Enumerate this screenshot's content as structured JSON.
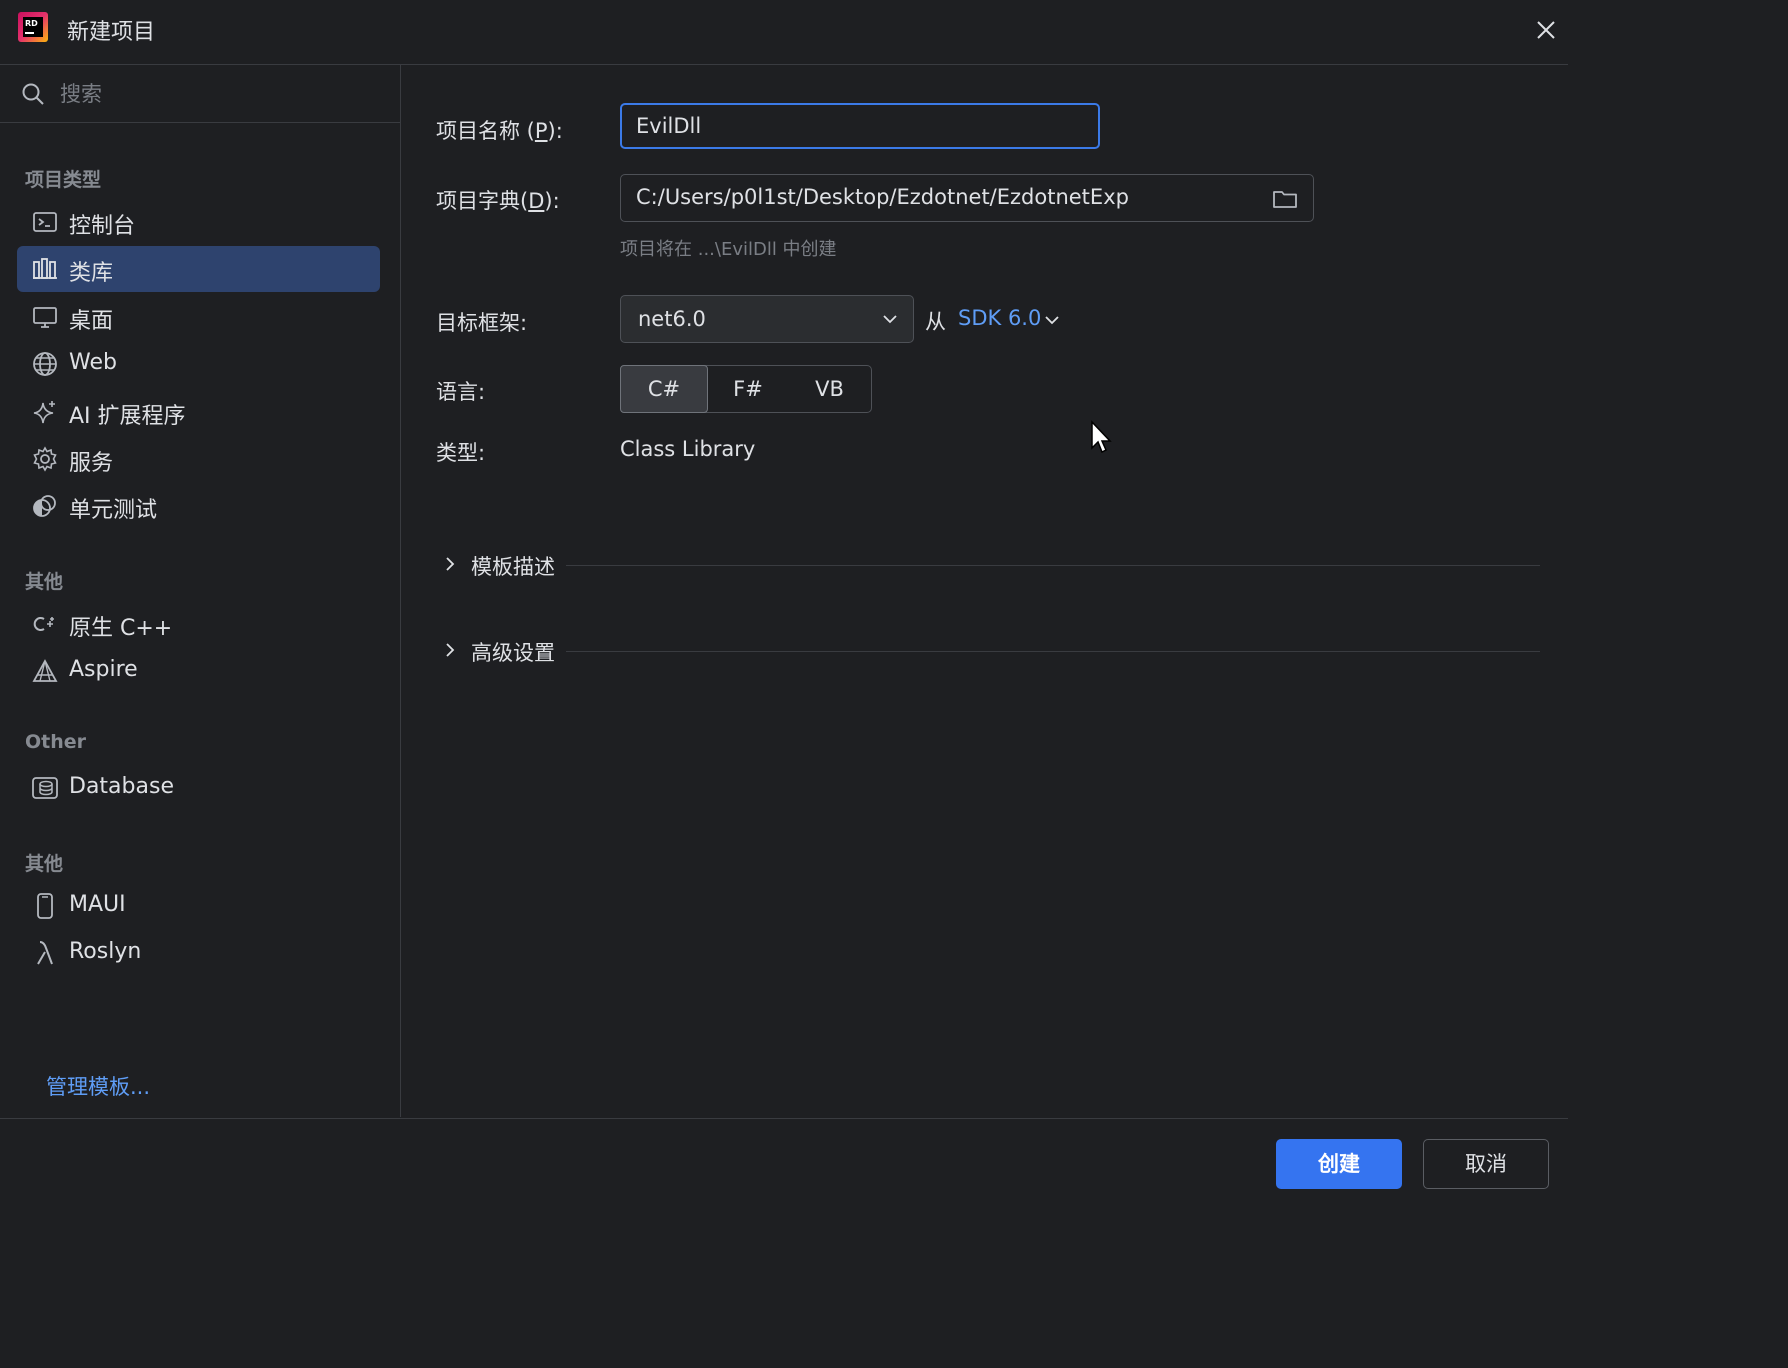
{
  "window": {
    "title": "新建项目",
    "logo_text": "RD"
  },
  "search": {
    "placeholder": "搜索"
  },
  "sidebar": {
    "sections": [
      {
        "title": "项目类型",
        "items": [
          {
            "label": "控制台",
            "icon": "console-icon"
          },
          {
            "label": "类库",
            "icon": "class-library-icon",
            "selected": true
          },
          {
            "label": "桌面",
            "icon": "desktop-icon"
          },
          {
            "label": "Web",
            "icon": "globe-icon"
          },
          {
            "label": "AI 扩展程序",
            "icon": "sparkle-icon"
          },
          {
            "label": "服务",
            "icon": "gear-icon"
          },
          {
            "label": "单元测试",
            "icon": "unit-test-icon"
          }
        ]
      },
      {
        "title": "其他",
        "items": [
          {
            "label": "原生 C++",
            "icon": "cpp-icon"
          },
          {
            "label": "Aspire",
            "icon": "aspire-icon"
          }
        ]
      },
      {
        "title": "Other",
        "items": [
          {
            "label": "Database",
            "icon": "database-icon"
          }
        ]
      },
      {
        "title": "其他",
        "items": [
          {
            "label": "MAUI",
            "icon": "mobile-icon"
          },
          {
            "label": "Roslyn",
            "icon": "lambda-icon"
          }
        ]
      }
    ],
    "manage_templates": "管理模板..."
  },
  "form": {
    "project_name_label": {
      "before": "项目名称 (",
      "mnemonic": "P",
      "after": "):"
    },
    "project_name_value": "EvilDll",
    "project_dir_label": {
      "before": "项目字典(",
      "mnemonic": "D",
      "after": "):"
    },
    "project_dir_value": "C:/Users/p0l1st/Desktop/Ezdotnet/EzdotnetExp",
    "hint": "项目将在 ...\\EvilDll 中创建",
    "framework_label": "目标框架:",
    "framework_value": "net6.0",
    "from_label": "从",
    "sdk_value": "SDK 6.0",
    "language_label": "语言:",
    "languages": [
      "C#",
      "F#",
      "VB"
    ],
    "selected_language": "C#",
    "type_label": "类型:",
    "type_value": "Class Library",
    "template_description": "模板描述",
    "advanced_settings": "高级设置"
  },
  "footer": {
    "create": "创建",
    "cancel": "取消"
  },
  "colors": {
    "accent": "#3574f0",
    "link": "#5f9df6",
    "selected_bg": "#2e436e",
    "background": "#1e1f22"
  }
}
